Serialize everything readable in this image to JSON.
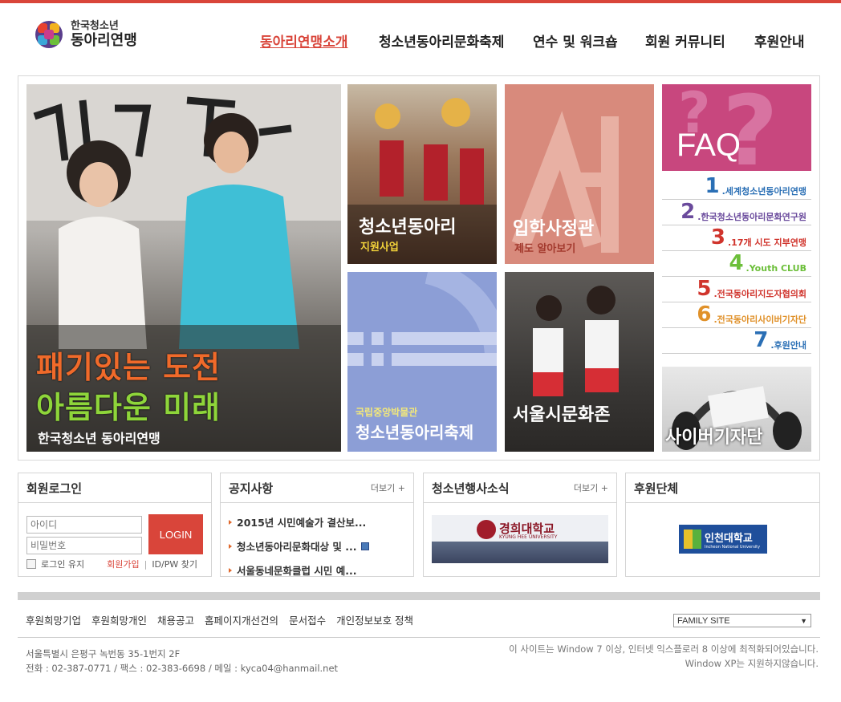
{
  "header": {
    "logo_small": "한국청소년",
    "logo_big": "동아리연맹",
    "nav": [
      {
        "label": "동아리연맹소개",
        "active": true
      },
      {
        "label": "청소년동아리문화축제",
        "active": false
      },
      {
        "label": "연수 및 워크숍",
        "active": false
      },
      {
        "label": "회원 커뮤니티",
        "active": false
      },
      {
        "label": "후원안내",
        "active": false
      }
    ]
  },
  "visual": {
    "main": {
      "line1": "패기있는 도전",
      "line2": "아름다운 미래",
      "line3": "한국청소년 동아리연맹"
    },
    "tiles": [
      {
        "title": "청소년동아리",
        "sub": "지원사업"
      },
      {
        "title": "입학사정관",
        "sub": "제도 알아보기"
      },
      {
        "sub": "국립중앙박물관",
        "title": "청소년동아리축제"
      },
      {
        "title": "서울시문화존"
      },
      {
        "title": "FAQ"
      },
      {
        "title": "사이버기자단"
      }
    ],
    "faq_items": [
      {
        "num": "1",
        "label": ".세계청소년동아리연맹",
        "color": "#2a6fb5"
      },
      {
        "num": "2",
        "label": ".한국청소년동아리문화연구원",
        "color": "#6a4a9c"
      },
      {
        "num": "3",
        "label": ".17개 시도 지부연맹",
        "color": "#d0342c"
      },
      {
        "num": "4",
        "label": ".Youth CLUB",
        "color": "#6cbf3a"
      },
      {
        "num": "5",
        "label": ".전국동아리지도자협의회",
        "color": "#d0342c"
      },
      {
        "num": "6",
        "label": ".전국동아리사이버기자단",
        "color": "#e0912a"
      },
      {
        "num": "7",
        "label": ".후원안내",
        "color": "#2a6fb5"
      }
    ]
  },
  "login": {
    "title": "회원로그인",
    "id_placeholder": "아이디",
    "pw_placeholder": "비밀번호",
    "button": "LOGIN",
    "remember": "로그인 유지",
    "join": "회원가입",
    "find": "ID/PW 찾기"
  },
  "notice": {
    "title": "공지사항",
    "more": "더보기 +",
    "items": [
      "2015년 시민예술가 결산보...",
      "청소년동아리문화대상 및 ...",
      "서울동네문화클럽 시민 예..."
    ]
  },
  "events": {
    "title": "청소년행사소식",
    "more": "더보기 +",
    "banner_kr": "경희대학교",
    "banner_en": "KYUNG HEE UNIVERSITY"
  },
  "sponsors": {
    "title": "후원단체",
    "logo_kr": "인천대학교",
    "logo_en": "Incheon National University"
  },
  "footer": {
    "links": [
      "후원희망기업",
      "후원희망개인",
      "채용공고",
      "홈페이지개선건의",
      "문서접수",
      "개인정보보호 정책"
    ],
    "family_site": "FAMILY SITE",
    "address": "서울특별시 은평구 녹번동 35-1번지 2F",
    "contact": "전화 : 02-387-0771 / 팩스 : 02-383-6698 / 메일 : kyca04@hanmail.net",
    "browser_note1": "이 사이트는 Window 7 이상, 인터넷 익스플로러 8 이상에 최적화되어있습니다.",
    "browser_note2": "Window XP는 지원하지않습니다."
  }
}
